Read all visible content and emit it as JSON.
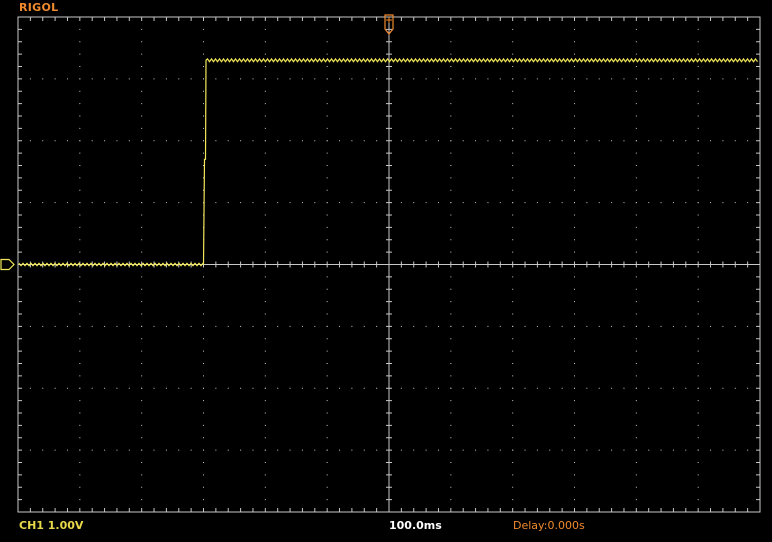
{
  "header": {
    "brand": "RIGOL"
  },
  "status": {
    "channel": "CH1 1.00V",
    "timebase": "100.0ms",
    "delay": "Delay:0.000s"
  },
  "colors": {
    "trace": "#f2e85a",
    "grid": "#c8c8c8",
    "brand": "#f08a2e",
    "trigger": "#f08a2e"
  },
  "icons": {
    "trigger_marker": "trigger-position-icon",
    "channel_marker": "channel-ground-icon"
  },
  "chart_data": {
    "type": "line",
    "divisions": {
      "horizontal": 12,
      "vertical": 8
    },
    "signal": {
      "low_level_div": 0.0,
      "high_level_div": 3.3,
      "step_time_div": -3.0,
      "glitch_level_div": 1.7
    }
  }
}
